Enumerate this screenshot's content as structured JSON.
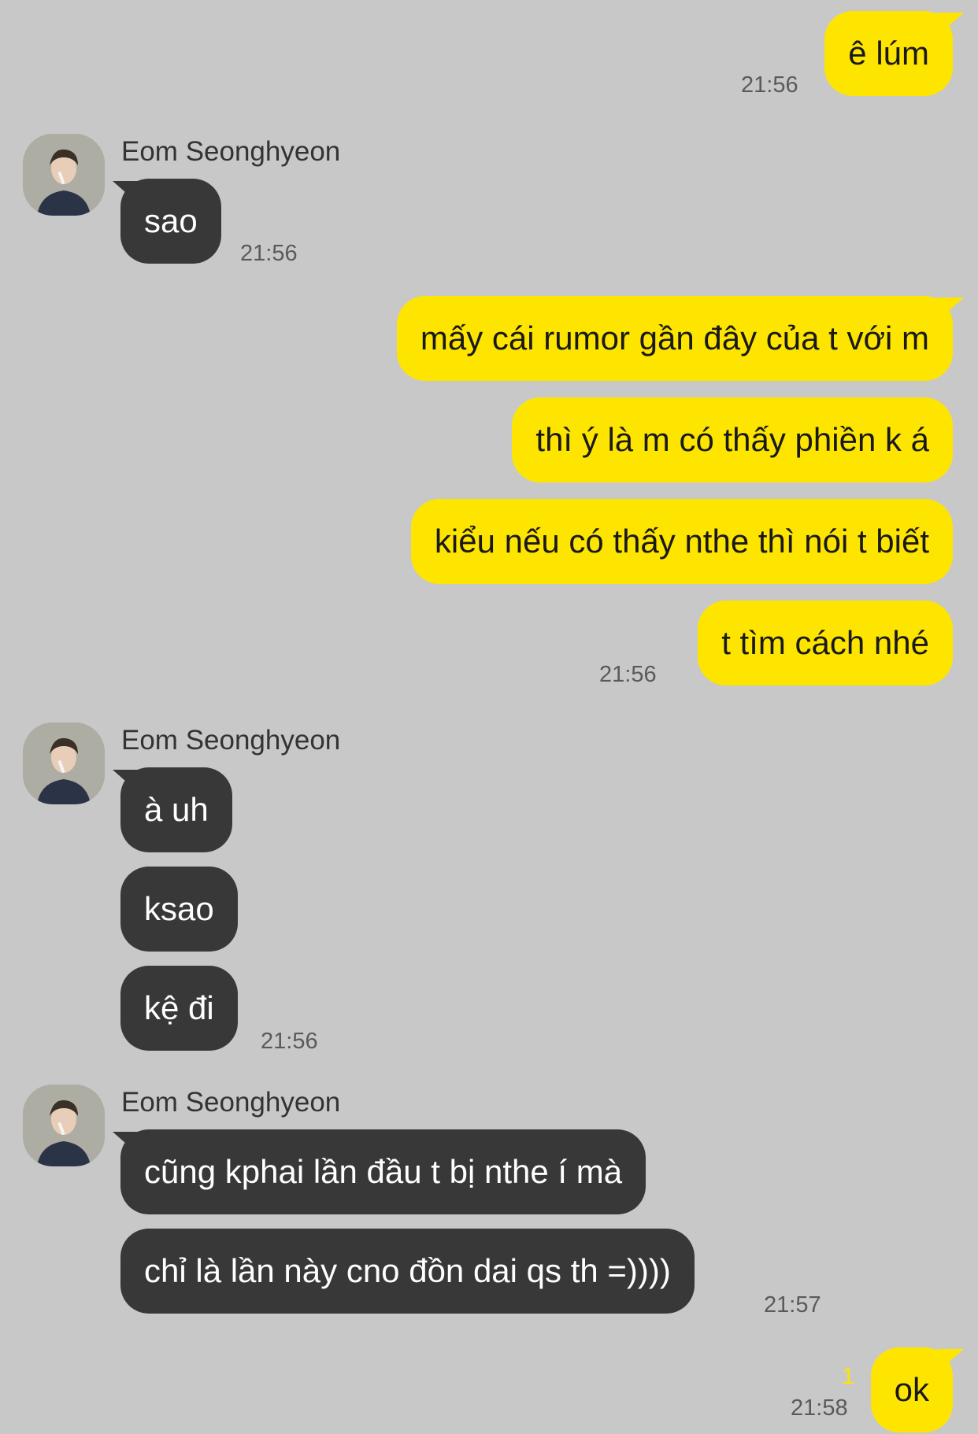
{
  "contact": {
    "name": "Eom Seonghyeon"
  },
  "messages": {
    "m1": {
      "text": "ê lúm",
      "time": "21:56"
    },
    "r1": {
      "text": "sao",
      "time": "21:56"
    },
    "m2": {
      "text": "mấy cái rumor gần đây của t với m"
    },
    "m3": {
      "text": "thì ý là m có thấy phiền k á"
    },
    "m4": {
      "text": "kiểu nếu có thấy nthe thì nói t biết"
    },
    "m5": {
      "text": "t tìm cách nhé",
      "time": "21:56"
    },
    "r2": {
      "text": "à uh"
    },
    "r3": {
      "text": "ksao"
    },
    "r4": {
      "text": "kệ đi",
      "time": "21:56"
    },
    "r5": {
      "text": "cũng kphai lần đầu t bị nthe í mà"
    },
    "r6": {
      "text": "chỉ là lần này cno đồn dai qs th =))))",
      "time": "21:57"
    },
    "m6": {
      "text": "ok",
      "time": "21:58",
      "unread": "1"
    }
  },
  "colors": {
    "background": "#c8c8c8",
    "my_bubble": "#fee500",
    "their_bubble": "#383838"
  }
}
